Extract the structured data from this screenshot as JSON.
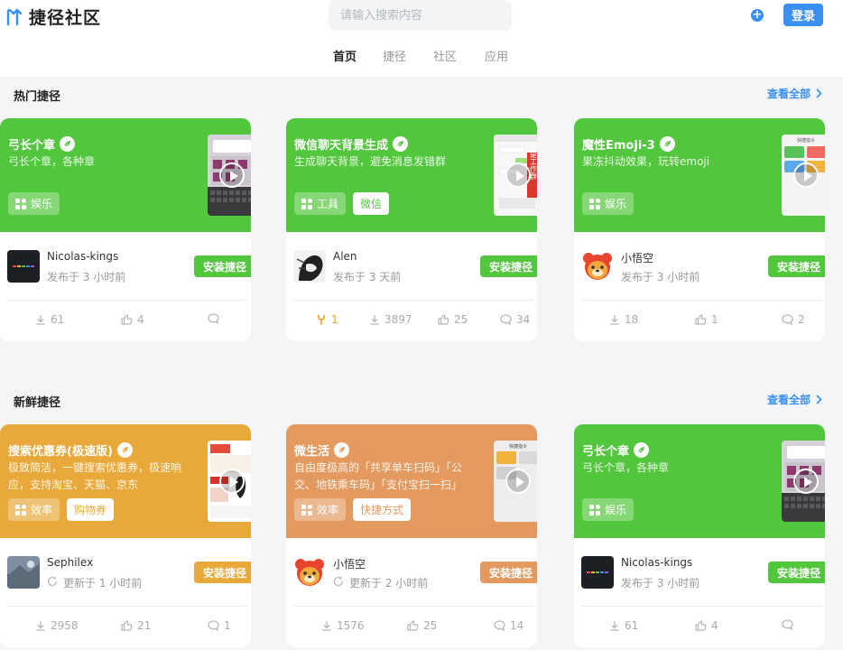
{
  "app": {
    "logo_text": "捷径社区"
  },
  "header": {
    "search_placeholder": "请输入搜索内容",
    "login_label": "登录",
    "nav": [
      "首页",
      "捷径",
      "社区",
      "应用"
    ]
  },
  "colors": {
    "accent": "#3a8ff2",
    "green": "#52c63c",
    "orange": "#e8a93a",
    "peach": "#e49a5f"
  },
  "sections": [
    {
      "title": "热门捷径",
      "more": "查看全部"
    },
    {
      "title": "新鲜捷径",
      "more": "查看全部"
    }
  ],
  "cards": [
    {
      "title": "弓长个章",
      "desc": "弓长个章，各种章",
      "color": "#52c63c",
      "category": "娱乐",
      "tag": "",
      "author": "Nicolas-kings",
      "time": "发布于 3 小时前",
      "updated": false,
      "install": "安装捷径",
      "downloads": "61",
      "likes": "4",
      "comments": "",
      "forks": ""
    },
    {
      "title": "微信聊天背景生成",
      "desc": "生成聊天背景，避免消息发错群",
      "color": "#52c63c",
      "category": "工具",
      "tag": "微信",
      "author": "Alen",
      "time": "发布于 3 天前",
      "updated": false,
      "install": "安装捷径",
      "downloads": "3897",
      "likes": "25",
      "comments": "34",
      "forks": "1"
    },
    {
      "title": "魔性Emoji-3",
      "desc": "果冻抖动效果，玩转emoji",
      "color": "#52c63c",
      "category": "娱乐",
      "tag": "",
      "author": "小悟空",
      "time": "发布于 3 小时前",
      "updated": false,
      "install": "安装捷径",
      "downloads": "18",
      "likes": "1",
      "comments": "2",
      "forks": ""
    },
    {
      "title": "搜索优惠券(极速版)",
      "desc": "极致简洁，一键搜索优惠券，极速响应，支持淘宝、天猫、京东",
      "color": "#e8a93a",
      "category": "效率",
      "tag": "购物券",
      "author": "Sephilex",
      "time": "更新于 1 小时前",
      "updated": true,
      "install": "安装捷径",
      "downloads": "2958",
      "likes": "21",
      "comments": "1",
      "forks": ""
    },
    {
      "title": "微生活",
      "desc": "自由度极高的「共享单车扫码」「公交、地铁乘车码」「支付宝扫一扫」",
      "color": "#e49a5f",
      "category": "效率",
      "tag": "快捷方式",
      "author": "小悟空",
      "time": "更新于 2 小时前",
      "updated": true,
      "install": "安装捷径",
      "downloads": "1576",
      "likes": "25",
      "comments": "14",
      "forks": ""
    },
    {
      "title": "弓长个章",
      "desc": "弓长个章，各种章",
      "color": "#52c63c",
      "category": "娱乐",
      "tag": "",
      "author": "Nicolas-kings",
      "time": "发布于 3 小时前",
      "updated": false,
      "install": "安装捷径",
      "downloads": "61",
      "likes": "4",
      "comments": "",
      "forks": ""
    }
  ],
  "thumb_text": {
    "wechat": "这是工作群",
    "app_header": "快捷指令"
  }
}
